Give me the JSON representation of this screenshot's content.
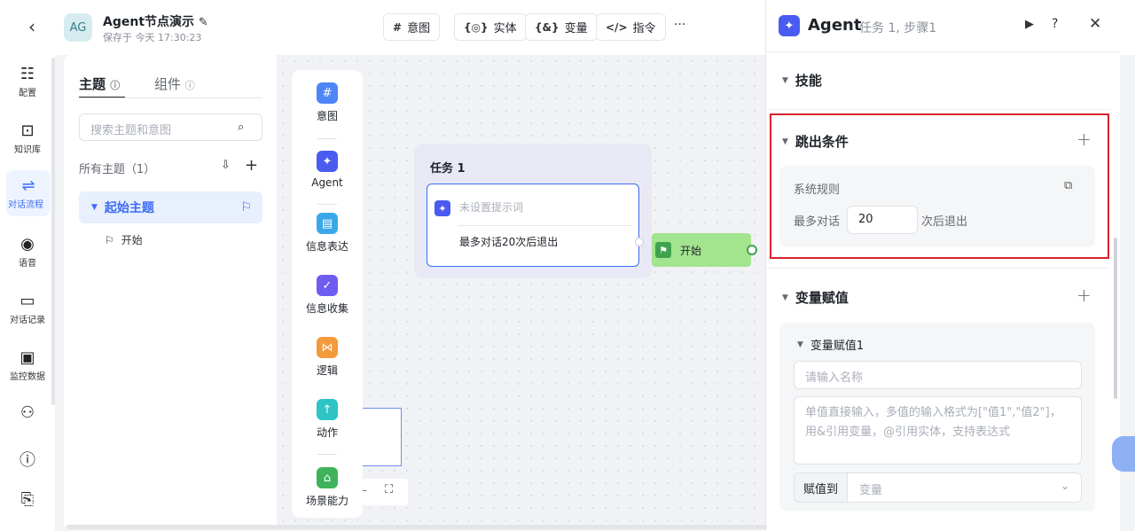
{
  "header": {
    "back_icon": "chevron-left-icon",
    "avatar": "AG",
    "app_name": "Agent节点演示",
    "edit_icon": "pencil-icon",
    "saved": "保存于 今天 17:30:23",
    "toolbar": [
      {
        "icon": "#",
        "label": "意图"
      },
      {
        "icon": "{◎}",
        "label": "实体"
      },
      {
        "icon": "{&}",
        "label": "变量"
      },
      {
        "icon": "</>",
        "label": "指令"
      }
    ],
    "more": "···"
  },
  "sidebar": {
    "items": [
      {
        "icon": "sliders-icon",
        "glyph": "☷",
        "label": "配置"
      },
      {
        "icon": "book-icon",
        "glyph": "⊡",
        "label": "知识库"
      },
      {
        "icon": "flow-icon",
        "glyph": "⇌",
        "label": "对话流程"
      },
      {
        "icon": "mic-icon",
        "glyph": "◉",
        "label": "语音"
      },
      {
        "icon": "chat-icon",
        "glyph": "▭",
        "label": "对话记录"
      },
      {
        "icon": "monitor-icon",
        "glyph": "▣",
        "label": "监控数据"
      }
    ],
    "extra_icons": [
      "plugin-icon",
      "help-icon",
      "doc-settings-icon"
    ]
  },
  "topics": {
    "tab_topic": "主题",
    "tab_component": "组件",
    "search_placeholder": "搜索主题和意图",
    "all_topics": "所有主题（1）",
    "root_topic": "起始主题",
    "start": "开始"
  },
  "palette": [
    {
      "label": "意图",
      "color": "#4f86f7",
      "glyph": "#"
    },
    {
      "label": "Agent",
      "color": "#4a5cf0",
      "glyph": "✦"
    },
    {
      "label": "信息表达",
      "color": "#3aa8e8",
      "glyph": "▤"
    },
    {
      "label": "信息收集",
      "color": "#6f5cf0",
      "glyph": "✓"
    },
    {
      "label": "逻辑",
      "color": "#f59a3c",
      "glyph": "⋈"
    },
    {
      "label": "动作",
      "color": "#2fc4c4",
      "glyph": "↑"
    },
    {
      "label": "场景能力",
      "color": "#3fb35c",
      "glyph": "⌂"
    }
  ],
  "canvas": {
    "task_title": "任务 1",
    "prompt_placeholder": "未设置提示词",
    "max_rule": "最多对话20次后退出",
    "start_label": "开始"
  },
  "panel": {
    "title": "Agent",
    "subtitle": "任务 1, 步骤1",
    "skills": "技能",
    "exit_conditions": "跳出条件",
    "system_rule": "系统规则",
    "max_dialog": "最多对话",
    "max_value": "20",
    "after_exit": "次后退出",
    "var_assign": "变量赋值",
    "var_assign_1": "变量赋值1",
    "name_placeholder": "请输入名称",
    "value_placeholder": "单值直接输入，多值的输入格式为[\"值1\",\"值2\"]，用&引用变量，@引用实体，支持表达式",
    "assign_to": "赋值到",
    "variable_placeholder": "变量"
  }
}
